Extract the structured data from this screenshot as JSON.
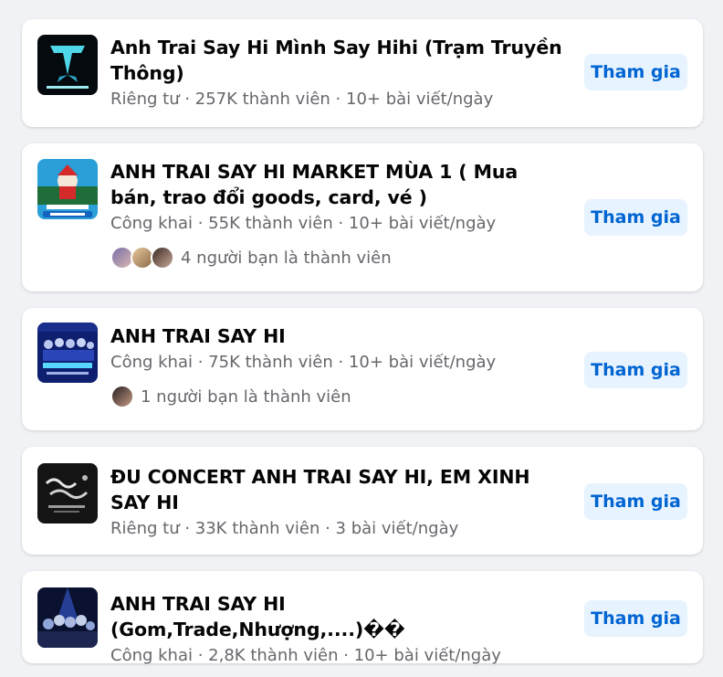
{
  "groups": [
    {
      "title": "Anh Trai Say Hi Mình Say Hihi (Trạm Truyền Thông)",
      "meta": "Riêng tư · 257K thành viên · 10+ bài viết/ngày",
      "join_label": "Tham gia",
      "thumb_icon": "ats-logo-icon"
    },
    {
      "title": "ANH TRAI SAY HI MARKET MÙA 1 ( Mua bán, trao đổi goods, card, vé )",
      "meta": "Công khai · 55K thành viên · 10+ bài viết/ngày",
      "friends_text": "4 người bạn là thành viên",
      "join_label": "Tham gia",
      "thumb_icon": "market-poster-icon"
    },
    {
      "title": "ANH TRAI SAY HI",
      "meta": "Công khai · 75K thành viên · 10+ bài viết/ngày",
      "friends_text": "1 người bạn là thành viên",
      "join_label": "Tham gia",
      "thumb_icon": "countdown-poster-icon"
    },
    {
      "title": "ĐU CONCERT ANH TRAI SAY HI, EM XINH SAY HI",
      "meta": "Riêng tư · 33K thành viên · 3 bài viết/ngày",
      "join_label": "Tham gia",
      "thumb_icon": "say-goodbye-poster-icon"
    },
    {
      "title": "ANH TRAI SAY HI (Gom,Trade,Nhượng,....)��",
      "meta": "Công khai · 2,8K thành viên · 10+ bài viết/ngày",
      "join_label": "Tham gia",
      "thumb_icon": "concert-crowd-icon"
    }
  ],
  "colors": {
    "background": "#f0f2f5",
    "card": "#ffffff",
    "title_text": "#050505",
    "meta_text": "#65676b",
    "join_bg": "#e7f3ff",
    "join_text": "#0064d1"
  }
}
